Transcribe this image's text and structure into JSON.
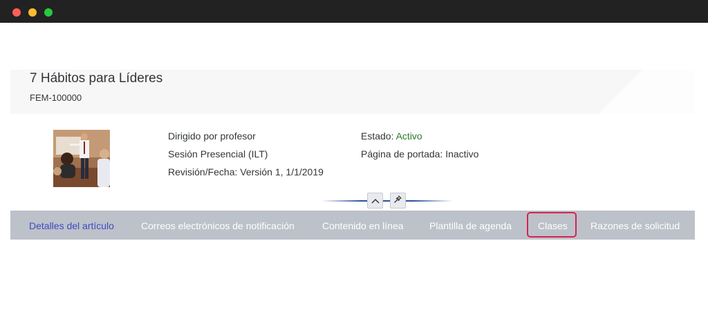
{
  "item": {
    "title": "7 Hábitos para Líderes",
    "id": "FEM-100000"
  },
  "details": {
    "delivery": "Dirigido por profesor",
    "session": "Sesión Presencial (ILT)",
    "revision": "Revisión/Fecha: Versión 1, 1/1/2019",
    "status_label": "Estado: ",
    "status_value": "Activo",
    "cover_page": "Página de portada: Inactivo"
  },
  "tabs": [
    {
      "label": "Detalles del artículo",
      "active": true
    },
    {
      "label": "Correos electrónicos de notificación",
      "active": false
    },
    {
      "label": "Contenido en línea",
      "active": false
    },
    {
      "label": "Plantilla de agenda",
      "active": false
    },
    {
      "label": "Clases",
      "active": false,
      "highlighted": true
    },
    {
      "label": "Razones de solicitud",
      "active": false
    }
  ],
  "controls": {
    "collapse_icon": "chevron-up-icon",
    "pin_icon": "pin-icon"
  },
  "colors": {
    "active_tab": "#3b4cc0",
    "status_active": "#2b7d2b",
    "highlight_border": "#d6224e",
    "tab_bar": "#bdc1c9"
  }
}
